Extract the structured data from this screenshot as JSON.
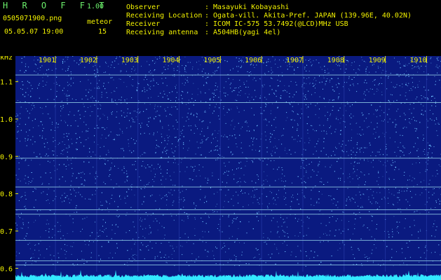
{
  "header": {
    "app_title": "H R O F F T",
    "version": "1.00",
    "filename": "0505071900.png",
    "meteor_label": "meteor",
    "datetime": "05.05.07 19:00",
    "meteor_count": "15"
  },
  "info": {
    "labels": [
      "Observer",
      "Receiving Location",
      "Receiver",
      "Receiving antenna"
    ],
    "values": [
      ": Masayuki Kobayashi",
      ": Ogata-vill. Akita-Pref. JAPAN (139.96E, 40.02N)",
      ": ICOM IC-575 53.7492(@LCD)MHz USB",
      ": A504HB(yagi 4el)"
    ]
  },
  "spectrogram": {
    "y_unit": "kHz",
    "y_ticks": [
      "1.1",
      "1.0",
      "0.9",
      "0.8",
      "0.7",
      "0.6"
    ],
    "y_tick_values": [
      1.1,
      1.0,
      0.9,
      0.8,
      0.7,
      0.6
    ],
    "y_range": [
      0.58,
      1.18
    ],
    "x_ticks": [
      "1901",
      "1902",
      "1903",
      "1904",
      "1905",
      "1906",
      "1907",
      "1908",
      "1909",
      "1910"
    ],
    "x_tick_values": [
      1901,
      1902,
      1903,
      1904,
      1905,
      1906,
      1907,
      1908,
      1909,
      1910
    ],
    "x_range": [
      1900.03,
      1910.35
    ],
    "horizontal_lines_khz": [
      1.118,
      1.044,
      0.895,
      0.818,
      0.757,
      0.745,
      0.675,
      0.62,
      0.609
    ],
    "background_color": "#0a1a80",
    "dot_color": "#6fc0ff",
    "grid_color": "#2a3fb0",
    "line_color": "#9fe0f0",
    "signal_color": "#33e8ff",
    "label_color": "#f2f200"
  }
}
